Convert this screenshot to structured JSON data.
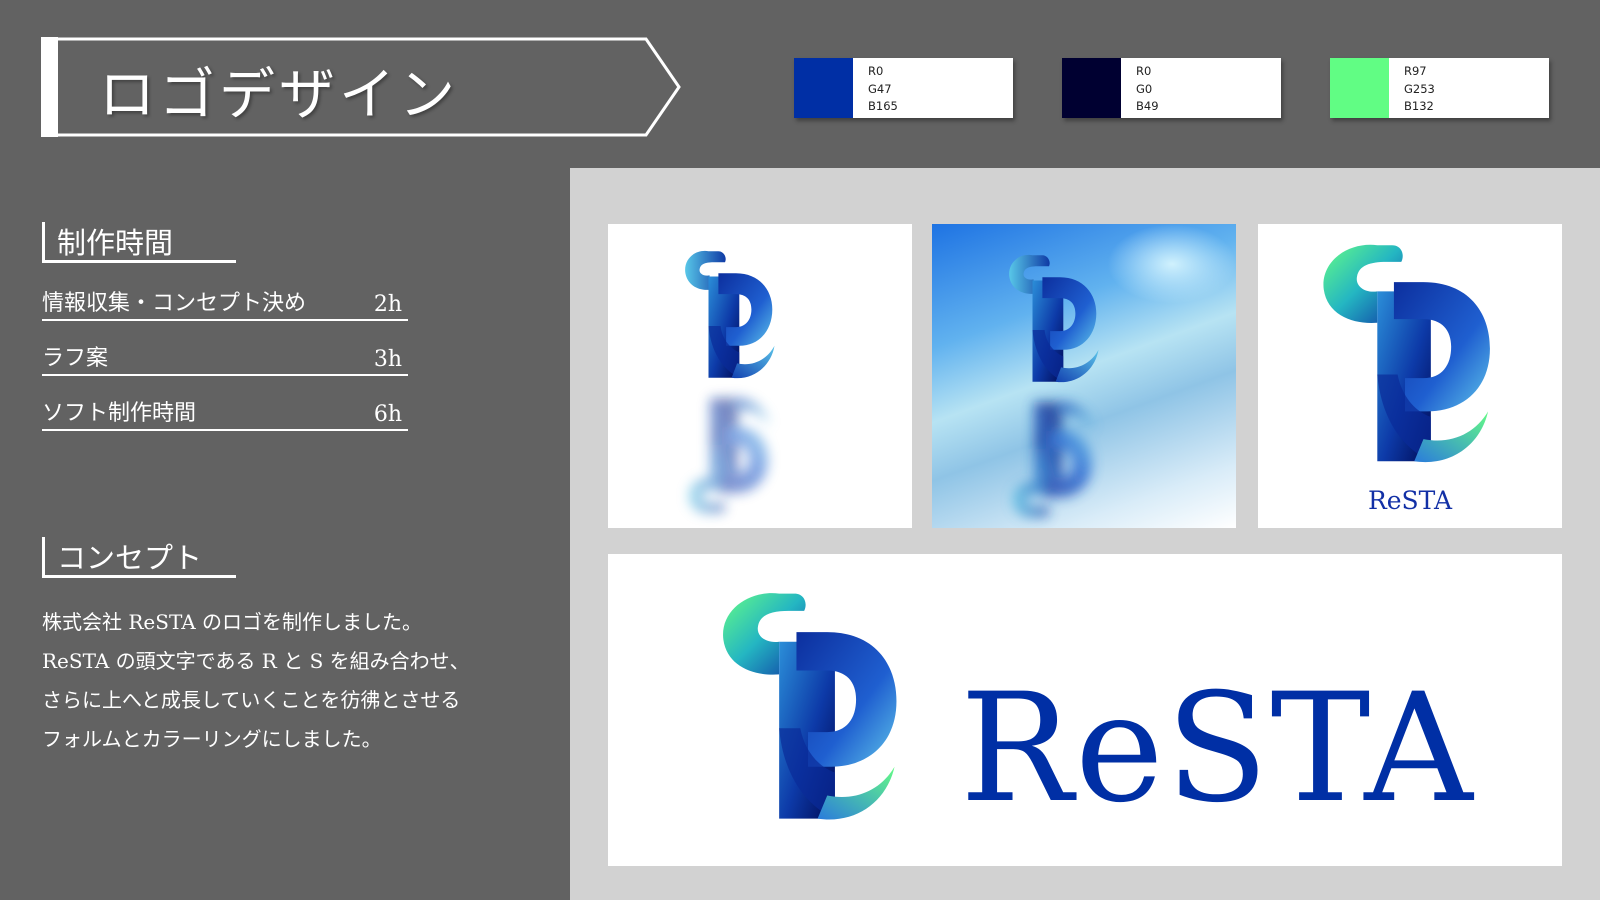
{
  "title": "ロゴデザイン",
  "colors": {
    "accent": "#002fa5",
    "panel_bg": "#626262",
    "gallery_bg": "#d2d2d2"
  },
  "swatches": [
    {
      "hex": "#002fa5",
      "r": "R0",
      "g": "G47",
      "b": "B165"
    },
    {
      "hex": "#000031",
      "r": "R0",
      "g": "G0",
      "b": "B49"
    },
    {
      "hex": "#61fd84",
      "r": "R97",
      "g": "G253",
      "b": "B132"
    }
  ],
  "production_time": {
    "heading": "制作時間",
    "rows": [
      {
        "label": "情報収集・コンセプト決め",
        "value": "2h"
      },
      {
        "label": "ラフ案",
        "value": "3h"
      },
      {
        "label": "ソフト制作時間",
        "value": "6h"
      }
    ]
  },
  "concept": {
    "heading": "コンセプト",
    "lines": [
      "株式会社 ReSTA のロゴを制作しました。",
      "ReSTA の頭文字である R と S を組み合わせ、",
      "さらに上へと成長していくことを彷彿とさせる",
      "フォルムとカラーリングにしました。"
    ]
  },
  "gallery": {
    "small_brand": "ReSTA",
    "big_brand": "ReSTA",
    "icon_names": [
      "resta-logo-icon",
      "resta-logo-reflection-icon"
    ]
  }
}
